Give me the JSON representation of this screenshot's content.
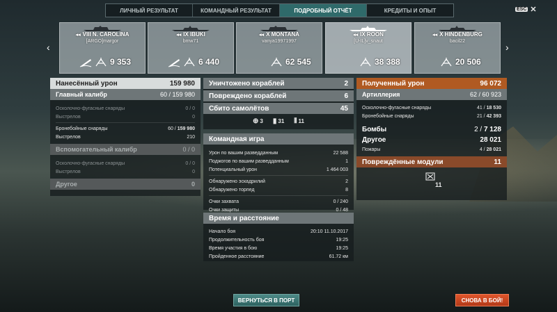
{
  "tabs": [
    {
      "label": "ЛИЧНЫЙ РЕЗУЛЬТАТ"
    },
    {
      "label": "КОМАНДНЫЙ РЕЗУЛЬТАТ"
    },
    {
      "label": "ПОДРОБНЫЙ ОТЧЁТ"
    },
    {
      "label": "КРЕДИТЫ И ОПЫТ"
    }
  ],
  "esc_label": "ESC",
  "ships": [
    {
      "name": "VIII N. CAROLINA",
      "player": "[ARGO]margor",
      "score": "9 353"
    },
    {
      "name": "IX IBUKI",
      "player": "bmw71",
      "score": "6 440"
    },
    {
      "name": "X MONTANA",
      "player": "vanya19971997",
      "score": "62 545"
    },
    {
      "name": "IX ROON",
      "player": "[U-IL]v_snaut",
      "score": "38 388"
    },
    {
      "name": "X HINDENBURG",
      "player": "bacil22",
      "score": "20 506"
    }
  ],
  "left": {
    "header": {
      "label": "Нанесённый урон",
      "value": "159 980"
    },
    "main": {
      "label": "Главный калибр",
      "value": "60 / 159 980"
    },
    "he": {
      "label": "Осколочно-фугасные снаряды",
      "value": "0 / 0"
    },
    "he_shots": {
      "label": "Выстрелов",
      "value": "0"
    },
    "ap": {
      "label": "Бронебойные снаряды",
      "value_a": "60 / ",
      "value_b": "159 980"
    },
    "ap_shots": {
      "label": "Выстрелов",
      "value": "210"
    },
    "secondary": {
      "label": "Вспомогательный калибр",
      "value": "0 / 0"
    },
    "sec_he": {
      "label": "Осколочно-фугасные снаряды",
      "value": "0 / 0"
    },
    "sec_shots": {
      "label": "Выстрелов",
      "value": "0"
    },
    "other": {
      "label": "Другое",
      "value": "0"
    }
  },
  "middle": {
    "destroyed": {
      "label": "Уничтожено кораблей",
      "value": "2"
    },
    "damaged": {
      "label": "Повреждено кораблей",
      "value": "6"
    },
    "planes": {
      "label": "Сбито самолётов",
      "value": "45"
    },
    "icons": [
      {
        "value": "3"
      },
      {
        "value": "31"
      },
      {
        "value": "11"
      }
    ],
    "team_header": "Командная игра",
    "team_rows": [
      {
        "label": "Урон по вашим разведданным",
        "value": "22 588"
      },
      {
        "label": "Поджогов по вашим разведданным",
        "value": "1"
      },
      {
        "label": "Потенциальный урон",
        "value": "1 464 003"
      },
      {
        "label": "Обнаружено эскадрилий",
        "value": "2"
      },
      {
        "label": "Обнаружено торпед",
        "value": "8"
      },
      {
        "label": "Очки захвата",
        "value": "0 / 240"
      },
      {
        "label": "Очки защиты",
        "value": "0 / 48"
      }
    ],
    "time_header": "Время и расстояние",
    "time_rows": [
      {
        "label": "Начало боя",
        "value": "20:10  11.10.2017"
      },
      {
        "label": "Продолжительность боя",
        "value": "19:25"
      },
      {
        "label": "Время участия в бою",
        "value": "19:25"
      },
      {
        "label": "Пройденное расстояние",
        "value": "61.72 км"
      }
    ]
  },
  "right": {
    "header": {
      "label": "Полученный урон",
      "value": "96 072"
    },
    "artillery": {
      "label": "Артиллерия",
      "value_a": "62 / ",
      "value_b": "60 923"
    },
    "he": {
      "label": "Осколочно-фугасные снаряды",
      "value_a": "41 / ",
      "value_b": "18 530"
    },
    "ap": {
      "label": "Бронебойные снаряды",
      "value_a": "21 / ",
      "value_b": "42 393"
    },
    "bombs": {
      "label": "Бомбы",
      "value_a": "2 / ",
      "value_b": "7 128"
    },
    "other": {
      "label": "Другое",
      "value": "28 021"
    },
    "fires": {
      "label": "Пожары",
      "value_a": "4 / ",
      "value_b": "28 021"
    },
    "modules": {
      "label": "Повреждённые модули",
      "value": "11"
    },
    "module_icon_value": "11"
  },
  "buttons": {
    "port": "ВЕРНУТЬСЯ В ПОРТ",
    "battle": "СНОВА В БОЙ!"
  },
  "colors": {
    "active_tab": "#2f6a6a",
    "received_header": "#b05a22",
    "battle_button": "#c8441f",
    "port_button": "#3d7774"
  }
}
